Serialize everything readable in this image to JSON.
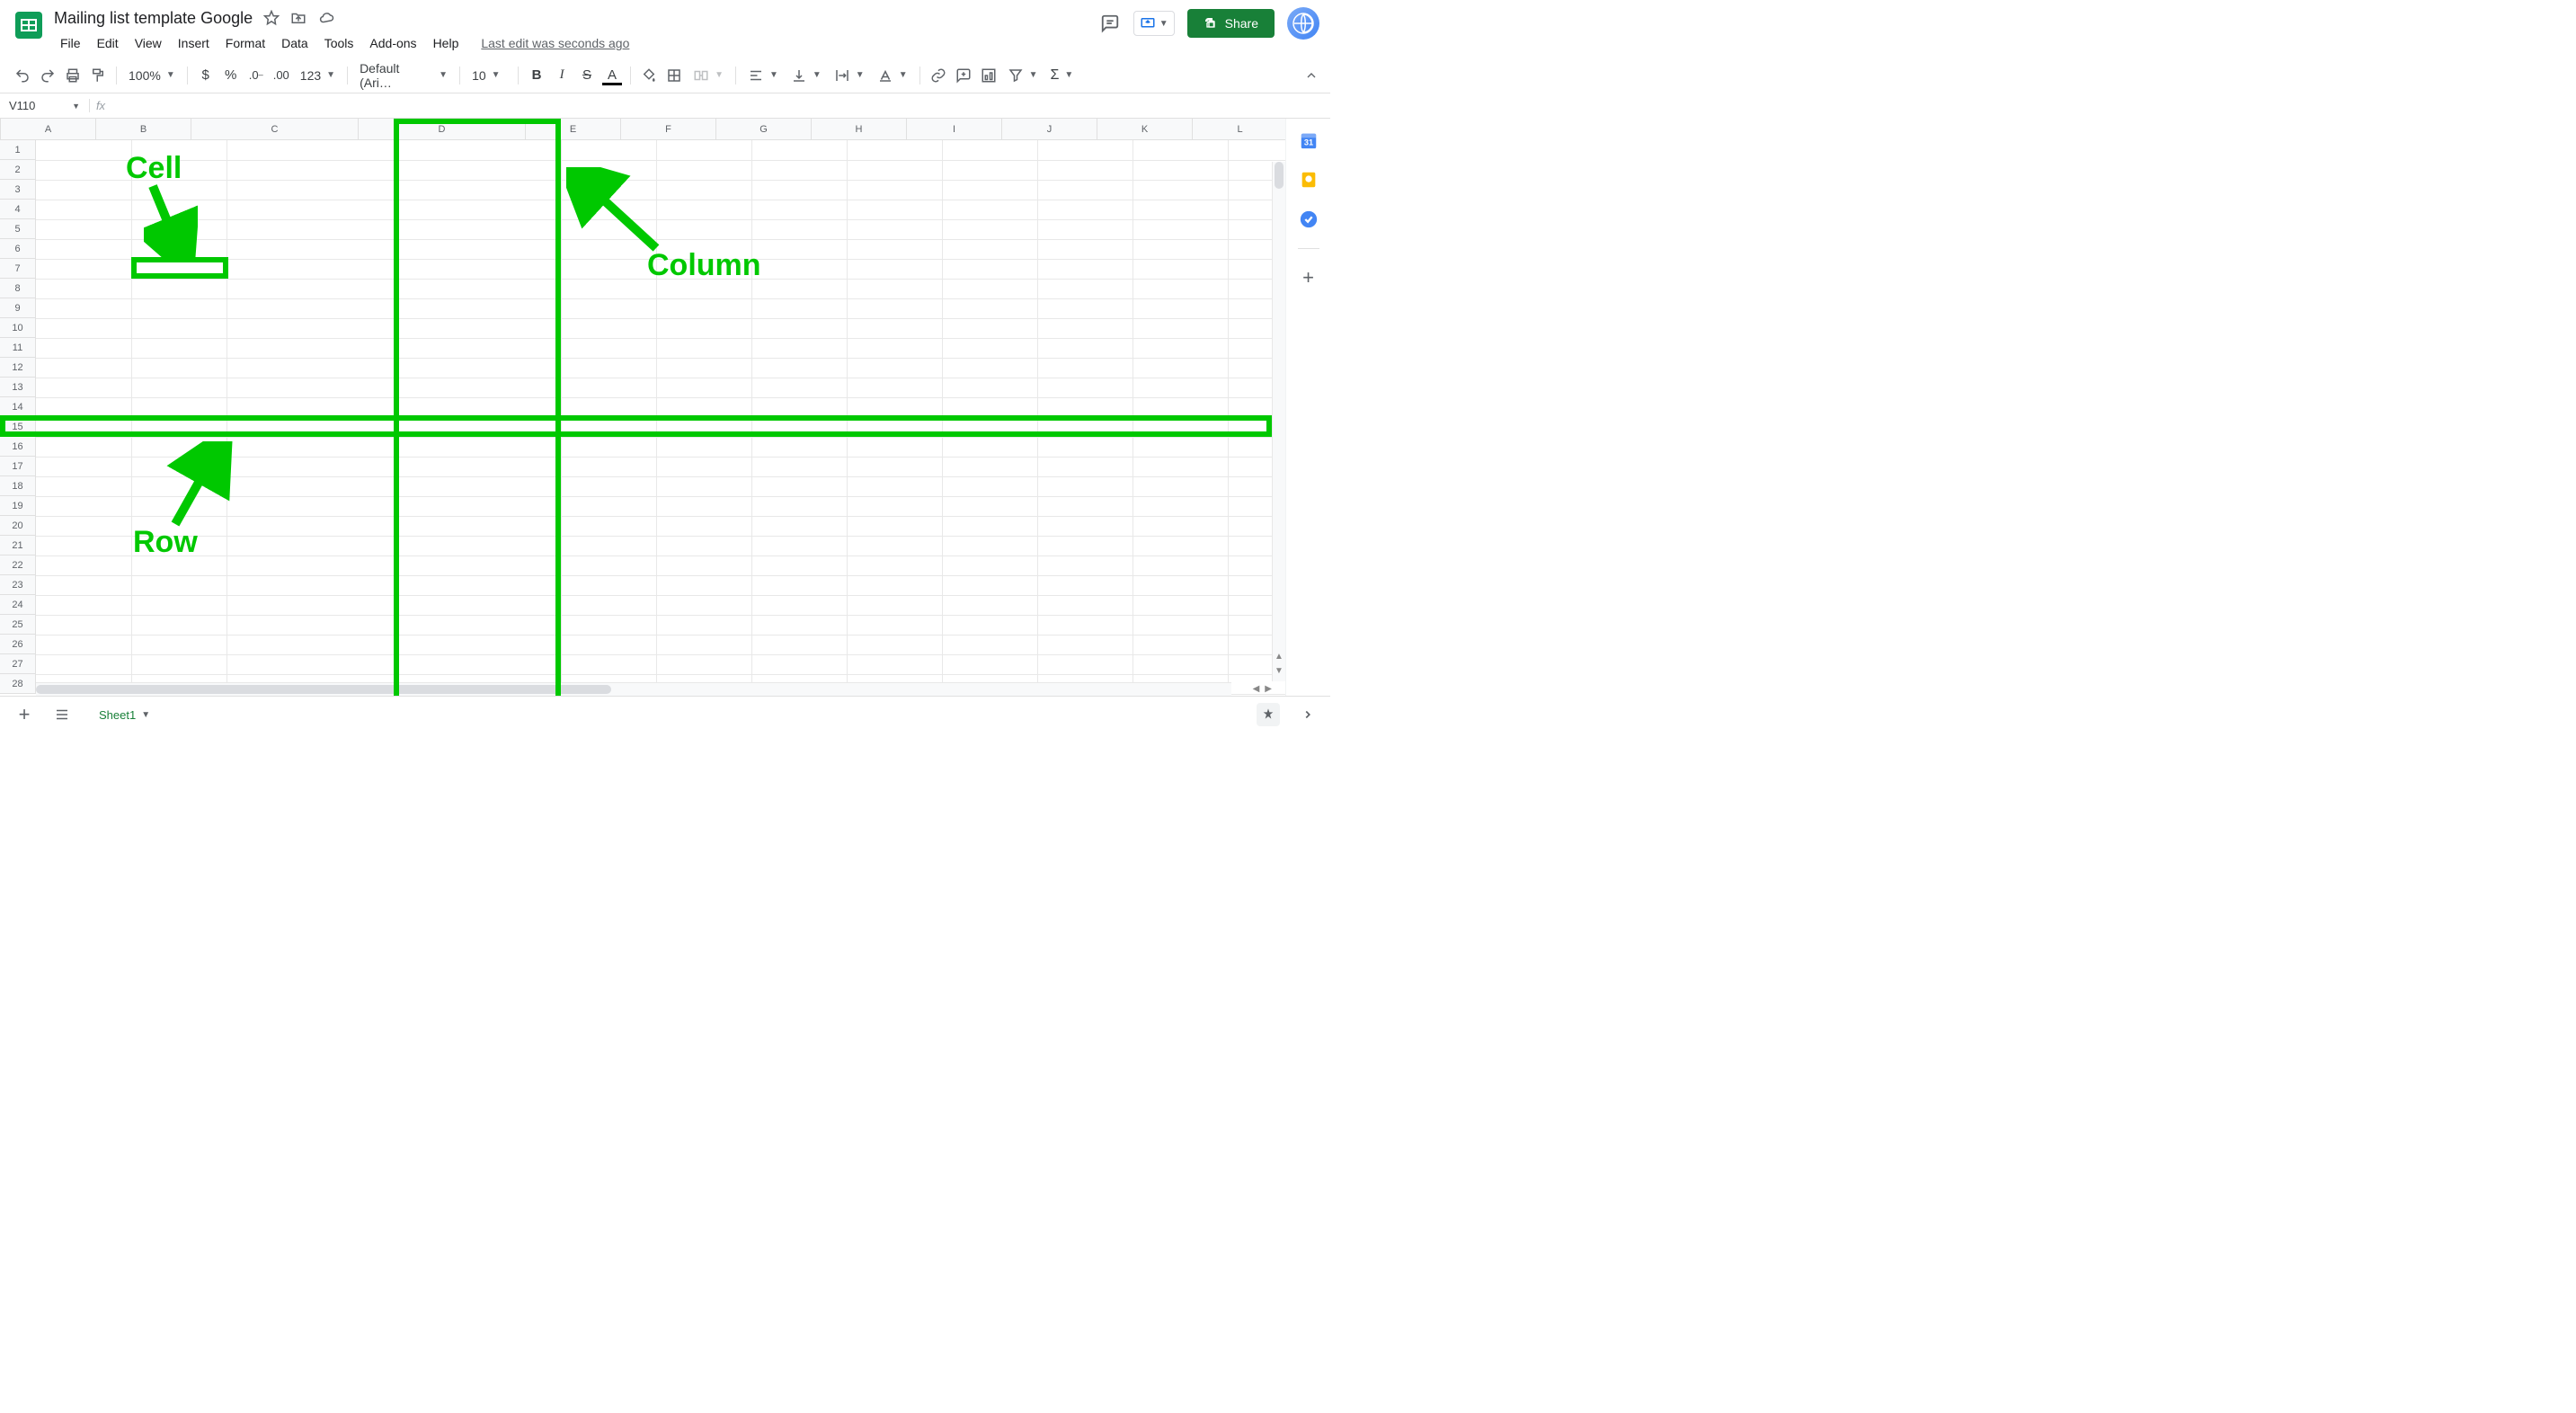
{
  "doc": {
    "title": "Mailing list template Google",
    "last_edit": "Last edit was seconds ago"
  },
  "menus": [
    "File",
    "Edit",
    "View",
    "Insert",
    "Format",
    "Data",
    "Tools",
    "Add-ons",
    "Help"
  ],
  "toolbar": {
    "zoom": "100%",
    "font": "Default (Ari…",
    "font_size": "10",
    "more_formats": "123"
  },
  "share_label": "Share",
  "namebox": {
    "ref": "V110"
  },
  "columns": [
    "A",
    "B",
    "C",
    "D",
    "E",
    "F",
    "G",
    "H",
    "I",
    "J",
    "K",
    "L"
  ],
  "rows": [
    "1",
    "2",
    "3",
    "4",
    "5",
    "6",
    "7",
    "8",
    "9",
    "10",
    "11",
    "12",
    "13",
    "14",
    "15",
    "16",
    "17",
    "18",
    "19",
    "20",
    "21",
    "22",
    "23",
    "24",
    "25",
    "26",
    "27",
    "28"
  ],
  "sheet_tab": "Sheet1",
  "annotations": {
    "cell_label": "Cell",
    "column_label": "Column",
    "row_label": "Row"
  }
}
